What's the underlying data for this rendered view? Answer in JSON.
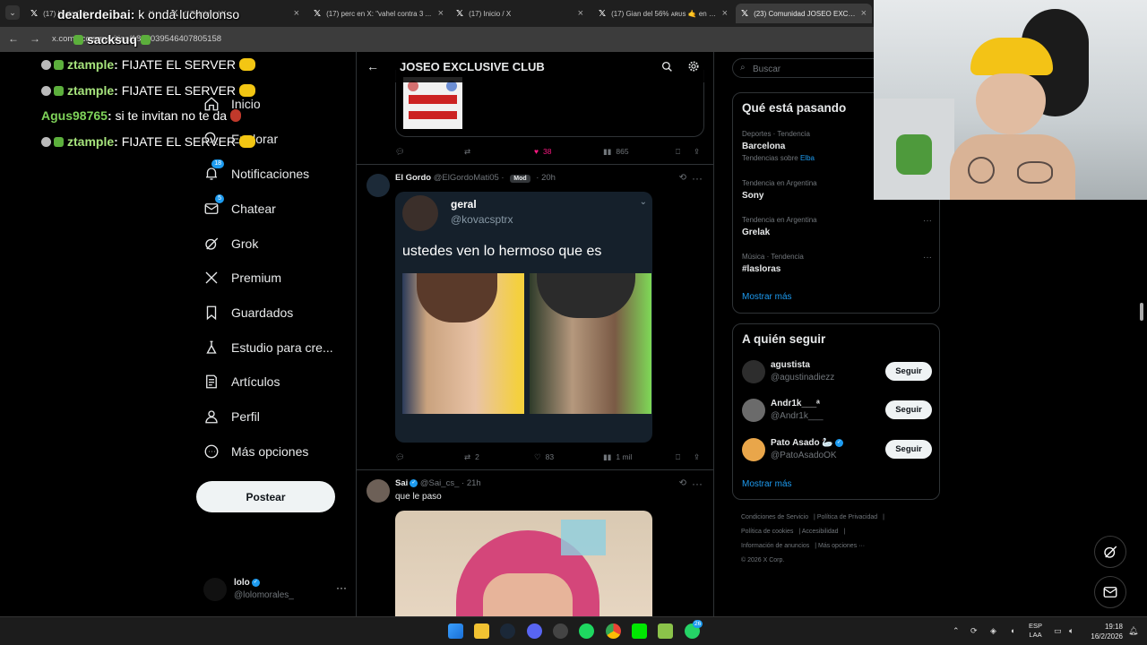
{
  "browser": {
    "tabs": [
      {
        "label": "(17) Inicio / X"
      },
      {
        "label": "(17) Inicio / X"
      },
      {
        "label": "(17) perc en X: \"vahel contra 3 ..."
      },
      {
        "label": "(17) Inicio / X"
      },
      {
        "label": "(17) Gian del 56% ᴀʀᴜs 🤙 en X..."
      },
      {
        "label": "(23) Comunidad JOSEO EXCLUSIVE..."
      }
    ],
    "url": "x.com/i/communities/1851039546407805158"
  },
  "chat": [
    {
      "user": "dealerdeibai",
      "message": "k onda lucholonso"
    },
    {
      "user": "sacksuq",
      "message": ""
    },
    {
      "user": "ztample",
      "message": "FIJATE EL SERVER"
    },
    {
      "user": "ztample",
      "message": "FIJATE EL SERVER"
    },
    {
      "user": "Agus98765",
      "message": "si te invitan no te da"
    },
    {
      "user": "ztample",
      "message": "FIJATE EL SERVER"
    }
  ],
  "nav": {
    "items": [
      {
        "label": "Inicio"
      },
      {
        "label": "Explorar"
      },
      {
        "label": "Notificaciones",
        "badge": "18"
      },
      {
        "label": "Chatear",
        "badge": "5"
      },
      {
        "label": "Grok"
      },
      {
        "label": "Premium"
      },
      {
        "label": "Guardados"
      },
      {
        "label": "Estudio para cre..."
      },
      {
        "label": "Artículos"
      },
      {
        "label": "Perfil"
      },
      {
        "label": "Más opciones"
      }
    ],
    "post_label": "Postear",
    "account": {
      "name": "lolo",
      "handle": "@lolomorales_"
    }
  },
  "main": {
    "title": "JOSEO EXCLUSIVE CLUB",
    "tweet0": {
      "likes": "38",
      "views": "865"
    },
    "tweet1": {
      "name": "El Gordo",
      "handle": "@ElGordoMati05",
      "role": "Mod",
      "time": "20h",
      "embed_name": "geral",
      "embed_handle": "@kovacsptrx",
      "embed_text": "ustedes ven lo hermoso que es",
      "reposts": "2",
      "likes": "83",
      "views": "1 mil"
    },
    "tweet2": {
      "name": "Sai",
      "handle": "@Sai_cs_",
      "time": "21h",
      "text": "que le paso"
    }
  },
  "sidebar": {
    "search_placeholder": "Buscar",
    "trends_title": "Qué está pasando",
    "trends": [
      {
        "context": "Deportes · Tendencia",
        "name": "Barcelona",
        "sub_prefix": "Tendencias sobre",
        "sub_link": "Elba"
      },
      {
        "context": "Tendencia en Argentina",
        "name": "Sony"
      },
      {
        "context": "Tendencia en Argentina",
        "name": "Grelak"
      },
      {
        "context": "Música · Tendencia",
        "name": "#lasloras"
      }
    ],
    "show_more": "Mostrar más",
    "who_to_follow_title": "A quién seguir",
    "follow": [
      {
        "name": "agustista",
        "handle": "@agustinadiezz",
        "button": "Seguir"
      },
      {
        "name": "Andr1k___ᵃ",
        "handle": "@Andr1k___",
        "button": "Seguir"
      },
      {
        "name": "Pato Asado 🦢",
        "handle": "@PatoAsadoOK",
        "button": "Seguir"
      }
    ],
    "footer": [
      "Condiciones de Servicio",
      "Política de Privacidad",
      "Política de cookies",
      "Accesibilidad",
      "Información de anuncios",
      "Más opciones ···",
      "© 2026 X Corp."
    ]
  },
  "taskbar": {
    "lang": "ESP",
    "lang2": "LAA",
    "time": "19:18",
    "date": "16/2/2026",
    "badge": "26"
  },
  "colors": {
    "accent": "#1d9bf0",
    "like": "#f91880",
    "chat_user": "#a6e37c"
  }
}
